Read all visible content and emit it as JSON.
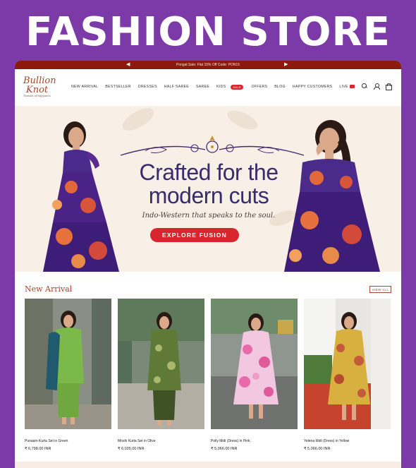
{
  "banner": {
    "title": "FASHION STORE"
  },
  "promo": {
    "text": "Pongal Sale: Flat 15% Off Code: PON15",
    "prev_icon": "arrow-left-icon",
    "next_icon": "arrow-right-icon"
  },
  "brand": {
    "line1": "Bullion",
    "line2": "Knot",
    "tagline": "Threads of Happiness"
  },
  "nav": {
    "items": [
      "NEW ARRIVAL",
      "BESTSELLER",
      "DRESSES",
      "HALF SAREE",
      "SAREE",
      "KIDS",
      "",
      "OFFERS",
      "BLOG",
      "HAPPY CUSTOMERS",
      "LIVE"
    ],
    "sale_badge": "SALE",
    "icons": [
      "search-icon",
      "user-icon",
      "bag-icon"
    ]
  },
  "hero": {
    "headline": "Crafted for the modern cuts",
    "subtitle": "Indo-Western that speaks to the soul.",
    "cta": "EXPLORE FUSION"
  },
  "new_arrival": {
    "title": "New Arrival",
    "view_all": "VIEW ALL",
    "products": [
      {
        "name": "Punaam Kurta Set in Green",
        "price": "₹ 6,798.00 INR"
      },
      {
        "name": "Moshi Kurta Set in Olive",
        "price": "₹ 6,035.00 INR"
      },
      {
        "name": "Polly Midi (Dress) in Pink",
        "price": "₹ 5,066.00 INR"
      },
      {
        "name": "Yelena Midi (Dress) in Yellow",
        "price": "₹ 5,066.00 INR"
      }
    ]
  },
  "colors": {
    "background": "#7b3aa8",
    "promo_bar": "#8a1a0c",
    "accent_red": "#d9262e",
    "headline_navy": "#3a2a6e",
    "brand_rust": "#a6472e",
    "hero_bg": "#f8f0e7"
  }
}
